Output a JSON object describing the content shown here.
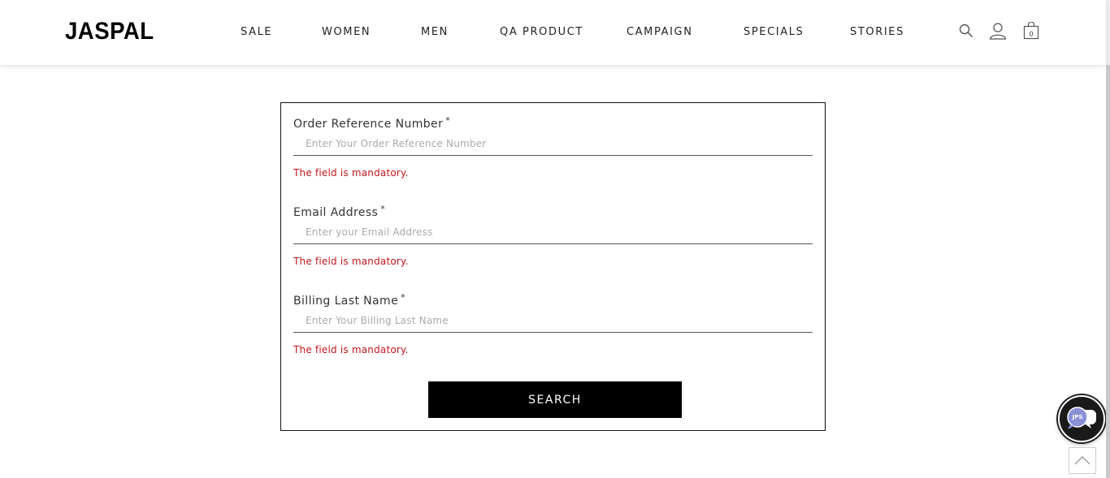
{
  "brand": {
    "logo_text": "JASPAL"
  },
  "nav": {
    "items": [
      {
        "label": "SALE"
      },
      {
        "label": "WOMEN"
      },
      {
        "label": "MEN"
      },
      {
        "label": "QA PRODUCT"
      },
      {
        "label": "CAMPAIGN"
      },
      {
        "label": "SPECIALS"
      },
      {
        "label": "STORIES"
      }
    ]
  },
  "header_icons": {
    "search": "search-icon",
    "account": "user-icon",
    "cart": "shopping-bag-icon",
    "cart_count": "0"
  },
  "form": {
    "fields": [
      {
        "label": "Order Reference Number",
        "required_mark": "*",
        "placeholder": "Enter Your Order Reference Number",
        "value": "",
        "error": "The field is mandatory."
      },
      {
        "label": "Email Address",
        "required_mark": "*",
        "placeholder": "Enter your Email Address",
        "value": "",
        "error": "The field is mandatory."
      },
      {
        "label": "Billing Last Name",
        "required_mark": "*",
        "placeholder": "Enter Your Billing Last Name",
        "value": "",
        "error": "The field is mandatory."
      }
    ],
    "submit_label": "SEARCH"
  },
  "widgets": {
    "chat": "chat-bubble-icon",
    "chat_badge_text": "JPS",
    "scroll_top": "chevron-up-icon"
  },
  "colors": {
    "error": "#c4161c",
    "button_bg": "#000000",
    "button_text": "#ffffff"
  }
}
